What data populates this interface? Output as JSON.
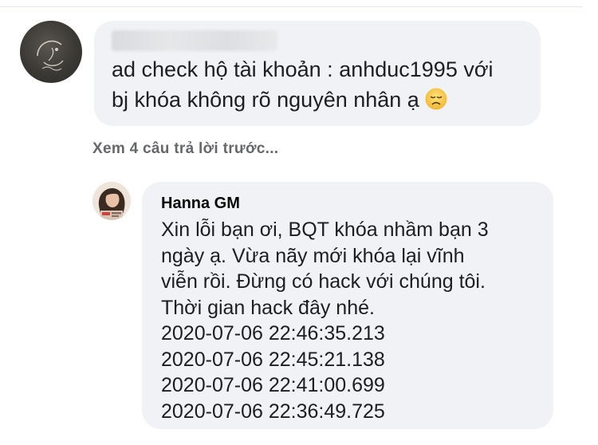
{
  "comment": {
    "author_blurred": true,
    "lines": [
      "ad check hộ tài khoản : anhduc1995 với",
      "bj khóa không rõ nguyên nhân ạ"
    ],
    "emoji": "disappointed-face-icon"
  },
  "see_previous_replies": "Xem 4 câu trả lời trước...",
  "reply": {
    "author": "Hanna GM",
    "lines": [
      "Xin lỗi bạn ơi, BQT khóa nhầm bạn 3",
      "ngày ạ. Vừa nãy mới khóa lại vĩnh",
      "viễn rồi. Đừng có hack với chúng tôi.",
      "Thời gian hack đây nhé.",
      "2020-07-06 22:46:35.213",
      "2020-07-06 22:45:21.138",
      "2020-07-06 22:41:00.699",
      "2020-07-06 22:36:49.725"
    ]
  },
  "colors": {
    "bubble": "#f0f2f5",
    "text": "#1c1e21",
    "meta_text": "#65676b",
    "emoji": "#f5c542"
  }
}
